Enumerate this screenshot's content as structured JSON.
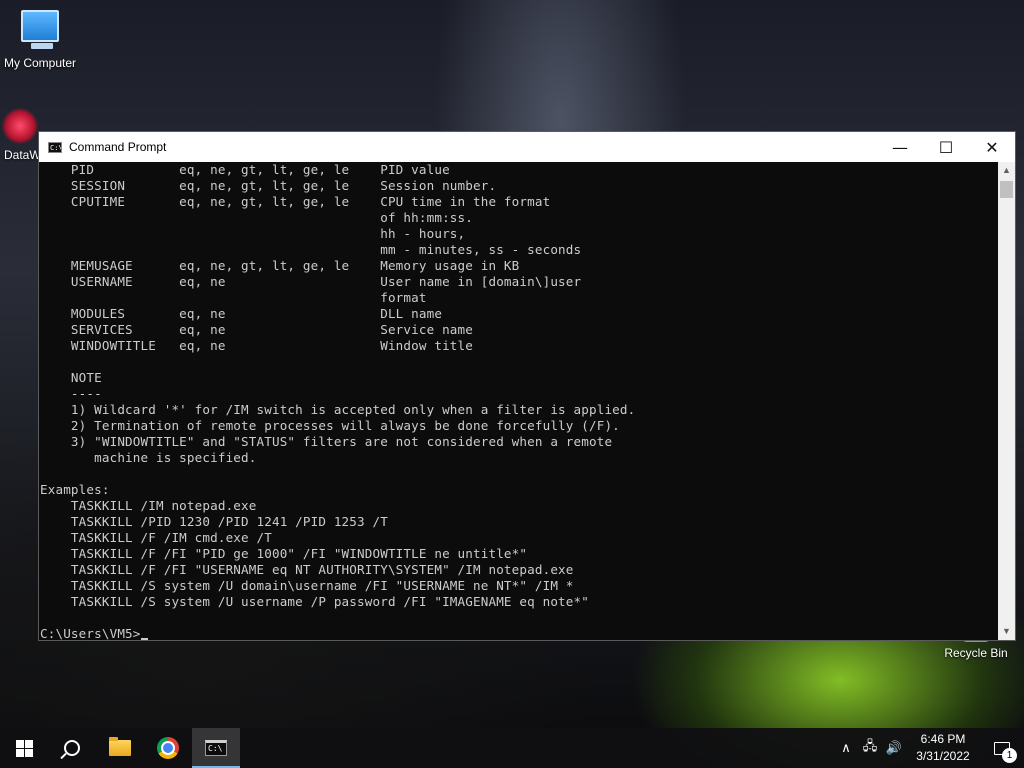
{
  "desktop": {
    "icons": [
      {
        "label": "My Computer",
        "icon": "computer-icon"
      },
      {
        "label": "DataW",
        "icon": "datawarehouse-icon"
      },
      {
        "label": "Recycle Bin",
        "icon": "recycle-bin-icon"
      }
    ]
  },
  "window": {
    "title": "Command Prompt",
    "buttons": {
      "minimize": "—",
      "maximize": "☐",
      "close": "✕"
    },
    "console_lines": [
      "    PID           eq, ne, gt, lt, ge, le    PID value",
      "    SESSION       eq, ne, gt, lt, ge, le    Session number.",
      "    CPUTIME       eq, ne, gt, lt, ge, le    CPU time in the format",
      "                                            of hh:mm:ss.",
      "                                            hh - hours,",
      "                                            mm - minutes, ss - seconds",
      "    MEMUSAGE      eq, ne, gt, lt, ge, le    Memory usage in KB",
      "    USERNAME      eq, ne                    User name in [domain\\]user",
      "                                            format",
      "    MODULES       eq, ne                    DLL name",
      "    SERVICES      eq, ne                    Service name",
      "    WINDOWTITLE   eq, ne                    Window title",
      "",
      "    NOTE",
      "    ----",
      "    1) Wildcard '*' for /IM switch is accepted only when a filter is applied.",
      "    2) Termination of remote processes will always be done forcefully (/F).",
      "    3) \"WINDOWTITLE\" and \"STATUS\" filters are not considered when a remote",
      "       machine is specified.",
      "",
      "Examples:",
      "    TASKKILL /IM notepad.exe",
      "    TASKKILL /PID 1230 /PID 1241 /PID 1253 /T",
      "    TASKKILL /F /IM cmd.exe /T",
      "    TASKKILL /F /FI \"PID ge 1000\" /FI \"WINDOWTITLE ne untitle*\"",
      "    TASKKILL /F /FI \"USERNAME eq NT AUTHORITY\\SYSTEM\" /IM notepad.exe",
      "    TASKKILL /S system /U domain\\username /FI \"USERNAME ne NT*\" /IM *",
      "    TASKKILL /S system /U username /P password /FI \"IMAGENAME eq note*\"",
      ""
    ],
    "prompt": "C:\\Users\\VM5>"
  },
  "taskbar": {
    "apps": [
      {
        "name": "start",
        "icon": "windows-logo-icon"
      },
      {
        "name": "search",
        "icon": "search-icon"
      },
      {
        "name": "file-explorer",
        "icon": "folder-icon"
      },
      {
        "name": "chrome",
        "icon": "chrome-icon"
      },
      {
        "name": "command-prompt",
        "icon": "cmd-icon",
        "active": true
      }
    ],
    "tray": {
      "chevron": "∧",
      "network": "🖧",
      "volume": "🔊",
      "time": "6:46 PM",
      "date": "3/31/2022",
      "notification_count": "1"
    }
  },
  "colors": {
    "console_bg": "#0c0c0c",
    "console_text": "#cccccc",
    "titlebar_bg": "#ffffff",
    "taskbar_bg": "#101012",
    "active_indicator": "#76b9ed"
  }
}
